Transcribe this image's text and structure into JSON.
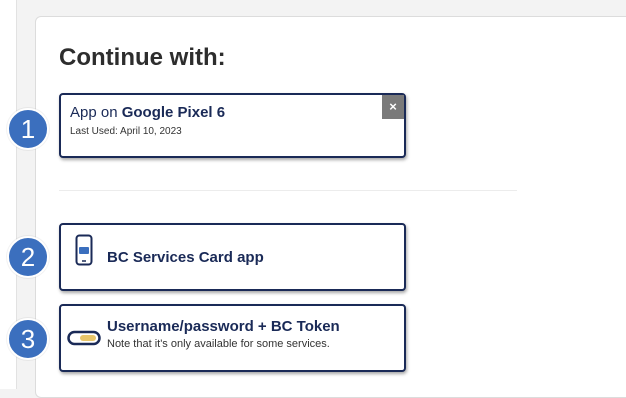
{
  "heading": "Continue with:",
  "options": [
    {
      "number": "1",
      "prefix": "App on ",
      "device": "Google Pixel 6",
      "subtitle": "Last Used: April 10, 2023",
      "close": "×"
    },
    {
      "number": "2",
      "title": "BC Services Card app",
      "icon": "phone-card-icon"
    },
    {
      "number": "3",
      "title": "Username/password + BC Token",
      "subtitle": "Note that it's only available for some services.",
      "icon": "token-key-icon"
    }
  ],
  "colors": {
    "navy": "#1a2a57",
    "badge": "#3b6fbe",
    "close": "#7a7a7a"
  }
}
